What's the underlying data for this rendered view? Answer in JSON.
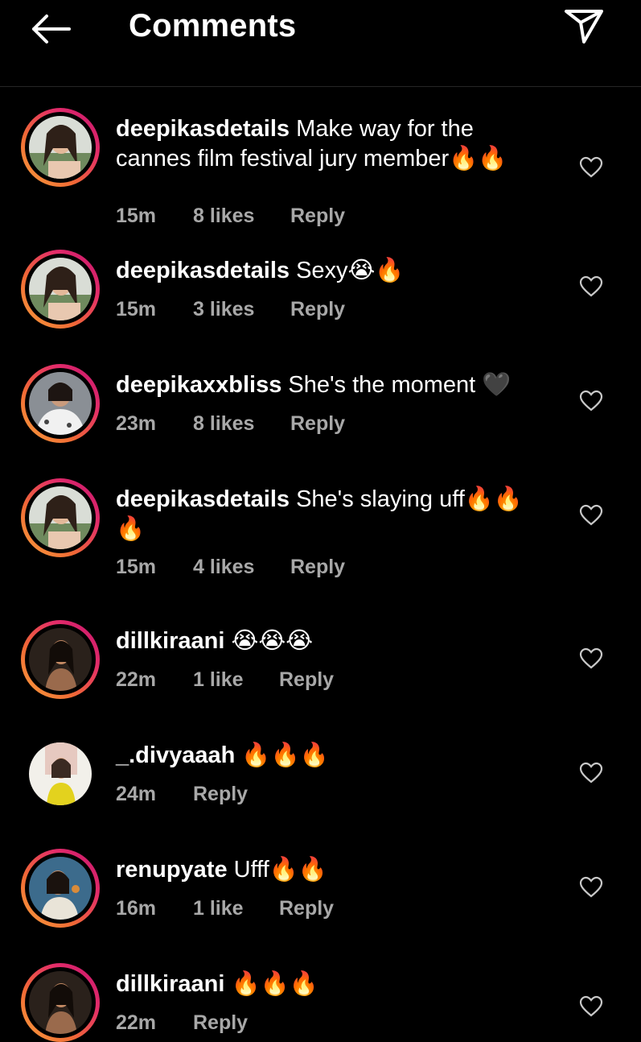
{
  "header": {
    "title": "Comments",
    "back_icon": "arrow-left-icon",
    "send_icon": "paper-plane-icon"
  },
  "colors": {
    "background": "#000000",
    "meta_text": "#a8a8a8",
    "story_ring_start": "#f9a13d",
    "story_ring_end": "#c4136e"
  },
  "comments": [
    {
      "username": "deepikasdetails",
      "text": "Make way for the cannes film festival jury member🔥🔥",
      "time": "15m",
      "likes": "8 likes",
      "reply": "Reply"
    },
    {
      "username": "deepikasdetails",
      "text": "Sexy😭🔥",
      "time": "15m",
      "likes": "3 likes",
      "reply": "Reply"
    },
    {
      "username": "deepikaxxbliss",
      "text": "She's the moment 🖤",
      "time": "23m",
      "likes": "8 likes",
      "reply": "Reply"
    },
    {
      "username": "deepikasdetails",
      "text": "She's slaying uff🔥🔥🔥",
      "time": "15m",
      "likes": "4 likes",
      "reply": "Reply"
    },
    {
      "username": "dillkiraani",
      "text": "😭😭😭",
      "time": "22m",
      "likes": "1 like",
      "reply": "Reply"
    },
    {
      "username": "_.divyaaah",
      "text": "🔥🔥🔥",
      "time": "24m",
      "likes": "",
      "reply": "Reply"
    },
    {
      "username": "renupyate",
      "text": "Ufff🔥🔥",
      "time": "16m",
      "likes": "1 like",
      "reply": "Reply"
    },
    {
      "username": "dillkiraani",
      "text": "🔥🔥🔥",
      "time": "22m",
      "likes": "",
      "reply": "Reply"
    }
  ]
}
